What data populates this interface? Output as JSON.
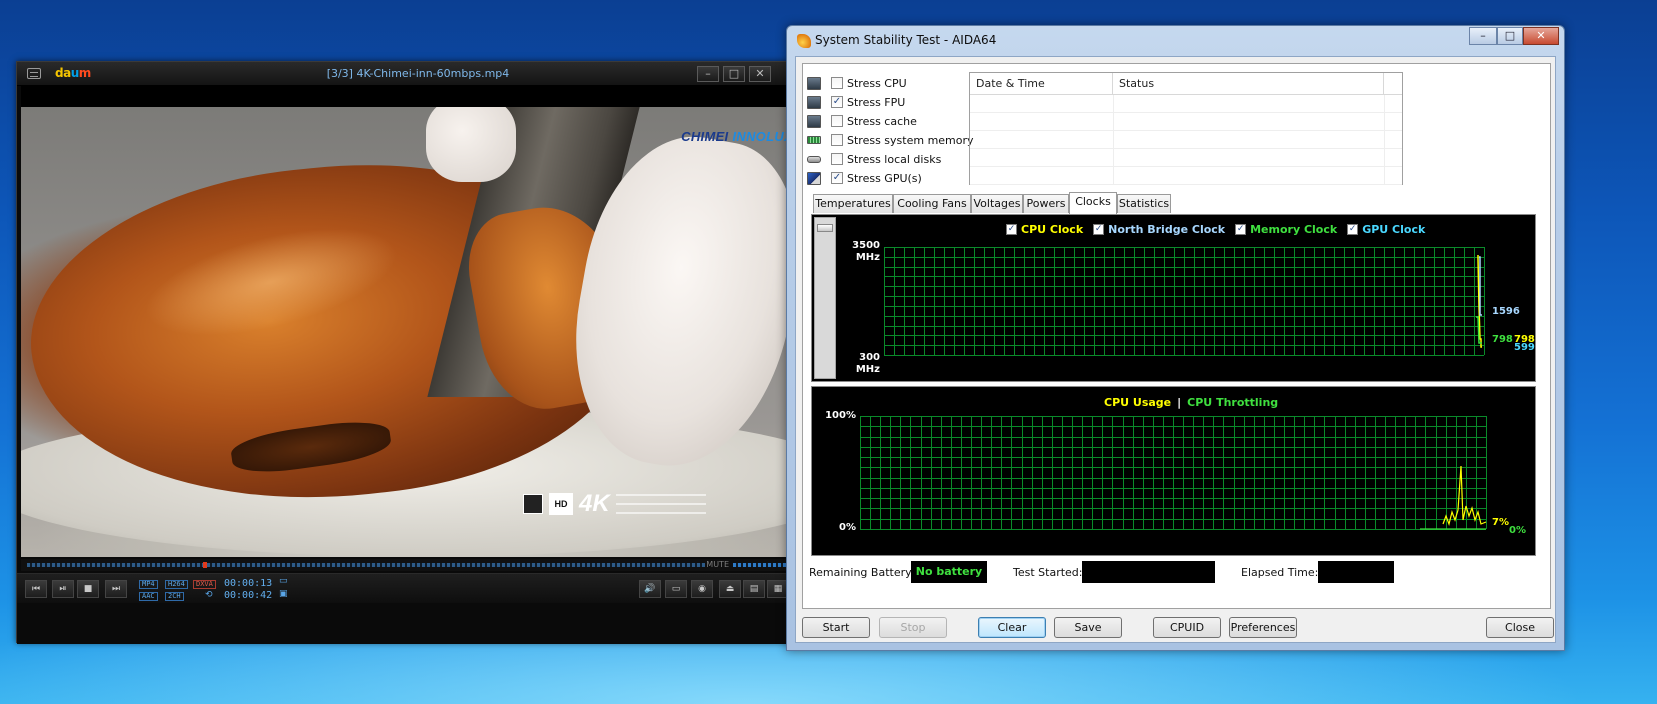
{
  "player": {
    "title": "[3/3] 4K-Chimei-inn-60mbps.mp4",
    "logo": [
      "da",
      "u",
      "m"
    ],
    "window_buttons": [
      "–",
      "□",
      "✕"
    ],
    "video": {
      "brand_left": "CHIMEI",
      "brand_right": "INNOLUX",
      "badge_hd": "HD",
      "badge_4k": "4K"
    },
    "mute_label": "MUTE",
    "progress": 0.26,
    "volume": 1.0,
    "codecs": {
      "video": "MP4",
      "video_codec": "H264",
      "container": "DXVA",
      "audio": "AAC",
      "channels": "2CH"
    },
    "current_time": "00:00:13",
    "total_time": "00:00:42",
    "transport": [
      "⏮",
      "⏯",
      "■",
      "⏭"
    ],
    "right_controls": [
      "🔊",
      "▭",
      "◉",
      "⏏",
      "▤",
      "▦"
    ]
  },
  "aida": {
    "title": "System Stability Test - AIDA64",
    "window_buttons": [
      "–",
      "□",
      "✕"
    ],
    "stress_options": [
      {
        "label": "Stress CPU",
        "checked": false,
        "icon": "cpu-icon"
      },
      {
        "label": "Stress FPU",
        "checked": true,
        "icon": "fpu-icon"
      },
      {
        "label": "Stress cache",
        "checked": false,
        "icon": "cache-icon"
      },
      {
        "label": "Stress system memory",
        "checked": false,
        "icon": "memory-icon"
      },
      {
        "label": "Stress local disks",
        "checked": false,
        "icon": "disk-icon"
      },
      {
        "label": "Stress GPU(s)",
        "checked": true,
        "icon": "gpu-icon"
      }
    ],
    "log_columns": [
      "Date & Time",
      "Status"
    ],
    "tabs": [
      "Temperatures",
      "Cooling Fans",
      "Voltages",
      "Powers",
      "Clocks",
      "Statistics"
    ],
    "active_tab": "Clocks",
    "clock_graph": {
      "legend": [
        {
          "label": "CPU Clock",
          "color": "#ffff00",
          "checked": true
        },
        {
          "label": "North Bridge Clock",
          "color": "#a8d8ff",
          "checked": true
        },
        {
          "label": "Memory Clock",
          "color": "#3fe03f",
          "checked": true
        },
        {
          "label": "GPU Clock",
          "color": "#4ad8ff",
          "checked": true
        }
      ],
      "y_max": "3500",
      "y_min": "300",
      "unit": "MHz",
      "values": {
        "north_bridge": "1596",
        "cpu": "798",
        "memory": "798",
        "gpu": "599"
      }
    },
    "usage_graph": {
      "legend_left": "CPU Usage",
      "legend_sep": "|",
      "legend_right": "CPU Throttling",
      "legend_left_color": "#ffff00",
      "legend_right_color": "#3fe03f",
      "y_max": "100%",
      "y_min": "0%",
      "value_usage": "7%",
      "value_throttle": "0%"
    },
    "status": {
      "battery_label": "Remaining Battery:",
      "battery_value": "No battery",
      "started_label": "Test Started:",
      "started_value": "",
      "elapsed_label": "Elapsed Time:",
      "elapsed_value": ""
    },
    "buttons": {
      "start": "Start",
      "stop": "Stop",
      "clear": "Clear",
      "save": "Save",
      "cpuid": "CPUID",
      "preferences": "Preferences",
      "close": "Close"
    }
  }
}
